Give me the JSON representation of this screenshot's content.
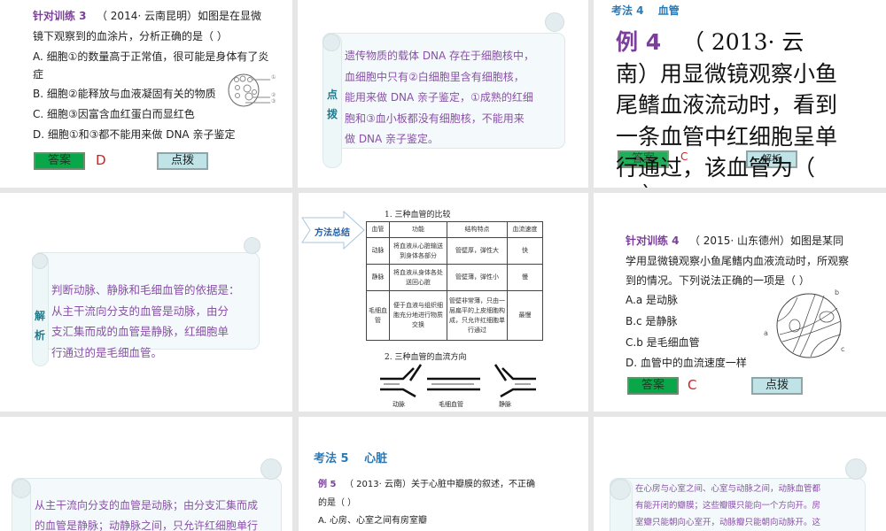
{
  "slides": [
    {
      "title": "针对训练 3",
      "source": "（ 2014· 云南昆明）如图是在显微",
      "question_line2": "镜下观察到的血涂片，分析正确的是（          ）",
      "options": [
        "A. 细胞①的数量高于正常值，很可能是身体有了炎",
        "症",
        "B. 细胞②能释放与血液凝固有关的物质",
        "C. 细胞③因富含血红蛋白而显红色",
        "D. 细胞①和③都不能用来做 DNA 亲子鉴定"
      ],
      "figure_labels": [
        "①",
        "②",
        "③"
      ],
      "answer_button": "答案",
      "answer": "D",
      "hint_button": "点拨"
    },
    {
      "side_label": [
        "点",
        "拨"
      ],
      "lines": [
        "遗传物质的载体 DNA 存在于细胞核中，",
        "血细胞中只有②白细胞里含有细胞核，",
        "能用来做 DNA 亲子鉴定，①成熟的红细",
        "胞和③血小板都没有细胞核，不能用来",
        "做 DNA 亲子鉴定。"
      ]
    },
    {
      "heading": "考法 4　 血管",
      "example_label": "例 4",
      "lines": [
        "（ 2013· 云",
        "南）用显微镜观察小鱼",
        "尾鳍血液流动时，看到",
        "一条血管中红细胞呈单",
        "行通过，该血管为（",
        "）"
      ],
      "answer_button": "答案",
      "answer": "C",
      "analysis_button": "解析"
    },
    {
      "side_label": [
        "解",
        "析"
      ],
      "lines": [
        "判断动脉、静脉和毛细血管的依据是：",
        "从主干流向分支的血管是动脉，由分",
        "支汇集而成的血管是静脉，红细胞单",
        "行通过的是毛细血管。"
      ]
    },
    {
      "badge": "方法总结",
      "table_title": "1. 三种血管的比较",
      "table_headers": [
        "血管",
        "功能",
        "结构特点",
        "血流速度"
      ],
      "table_rows": [
        [
          "动脉",
          "将血液从心脏输送到身体各部分",
          "管壁厚，弹性大",
          "快"
        ],
        [
          "静脉",
          "将血液从身体各处送回心脏",
          "管壁薄，弹性小",
          "慢"
        ],
        [
          "毛细血管",
          "便于血液与组织细胞充分地进行物质交换",
          "管壁非常薄，只由一层扁平的上皮细胞构成，只允许红细胞单行通过",
          "最慢"
        ]
      ],
      "diagram_title": "2. 三种血管的血流方向",
      "diagram_labels": [
        "动脉",
        "毛细血管",
        "静脉"
      ]
    },
    {
      "title": "针对训练 4",
      "source": "（ 2015· 山东德州）如图是某同",
      "lines": [
        "学用显微镜观察小鱼尾鳍内血液流动时，所观察",
        "到的情况。下列说法正确的一项是（          ）"
      ],
      "options": [
        "A.a 是动脉",
        "B.c 是静脉",
        "C.b 是毛细血管",
        "D. 血管中的血流速度一样"
      ],
      "figure_labels": [
        "a",
        "b",
        "c"
      ],
      "answer_button": "答案",
      "answer": "C",
      "hint_button": "点拨"
    },
    {
      "lines": [
        "从主干流向分支的血管是动脉；由分支汇集而成",
        "的血管是静脉；动静脉之间，只允许红细胞单行"
      ]
    },
    {
      "heading": "考法 5　 心脏",
      "example_label": "例 5",
      "question": "（ 2013· 云南）关于心脏中瓣膜的叙述，不正确",
      "question_line2": "的是（          ）",
      "options": [
        "A. 心房、心室之间有房室瓣"
      ]
    },
    {
      "lines": [
        "在心房与心室之间、心室与动脉之间，动脉血管都",
        "有能开闭的瓣膜；这些瓣膜只能向一个方向开。房",
        "室瓣只能朝向心室开，动脉瓣只能朝向动脉开。这"
      ]
    }
  ],
  "colors": {
    "title_purple": "#7b3f9a",
    "heading_blue": "#2a7ab8",
    "answer_red": "#d41f1f",
    "answer_green": "#0aa64a",
    "hint_cyan": "#bfe3e7",
    "background": "#e6e6e6"
  }
}
